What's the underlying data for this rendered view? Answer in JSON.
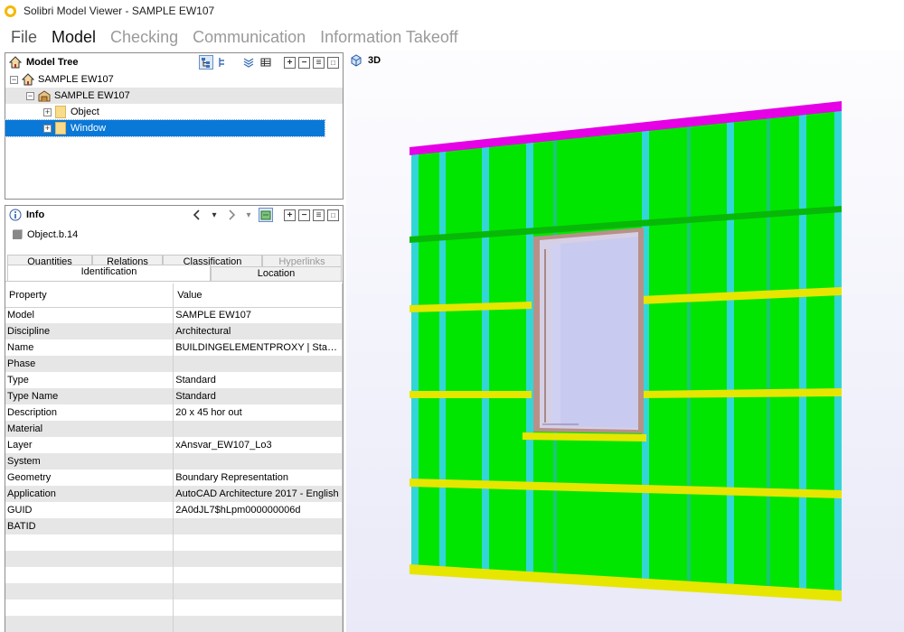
{
  "window": {
    "title": "Solibri Model Viewer - SAMPLE EW107"
  },
  "menu": {
    "items": [
      "File",
      "Model",
      "Checking",
      "Communication",
      "Information Takeoff"
    ]
  },
  "model_tree": {
    "title": "Model Tree",
    "nodes": [
      {
        "label": "SAMPLE EW107",
        "expander": "−"
      },
      {
        "label": "SAMPLE EW107",
        "expander": "−"
      },
      {
        "label": "Object",
        "expander": "+"
      },
      {
        "label": "Window",
        "expander": "+"
      }
    ]
  },
  "info": {
    "title": "Info",
    "object_name": "Object.b.14",
    "tabs_row1": [
      "Quantities",
      "Relations",
      "Classification",
      "Hyperlinks"
    ],
    "tabs_row2": [
      "Identification",
      "Location"
    ],
    "columns": [
      "Property",
      "Value"
    ],
    "rows": [
      [
        "Model",
        "SAMPLE EW107"
      ],
      [
        "Discipline",
        "Architectural"
      ],
      [
        "Name",
        "BUILDINGELEMENTPROXY | Standa..."
      ],
      [
        "Phase",
        ""
      ],
      [
        "Type",
        "Standard"
      ],
      [
        "Type Name",
        "Standard"
      ],
      [
        "Description",
        "20 x 45 hor out"
      ],
      [
        "Material",
        ""
      ],
      [
        "Layer",
        "xAnsvar_EW107_Lo3"
      ],
      [
        "System",
        ""
      ],
      [
        "Geometry",
        "Boundary Representation"
      ],
      [
        "Application",
        "AutoCAD Architecture 2017 - English"
      ],
      [
        "GUID",
        "2A0dJL7$hLpm000000006d"
      ],
      [
        "BATID",
        ""
      ]
    ]
  },
  "view": {
    "title": "3D"
  },
  "colors": {
    "selection": "#0a78d7",
    "wall": "#00e600",
    "stud": "#33d6d6",
    "batten": "#e6e600",
    "top_plate": "#e600e6",
    "glass": "#cfd0f2",
    "frame": "#b89088"
  }
}
